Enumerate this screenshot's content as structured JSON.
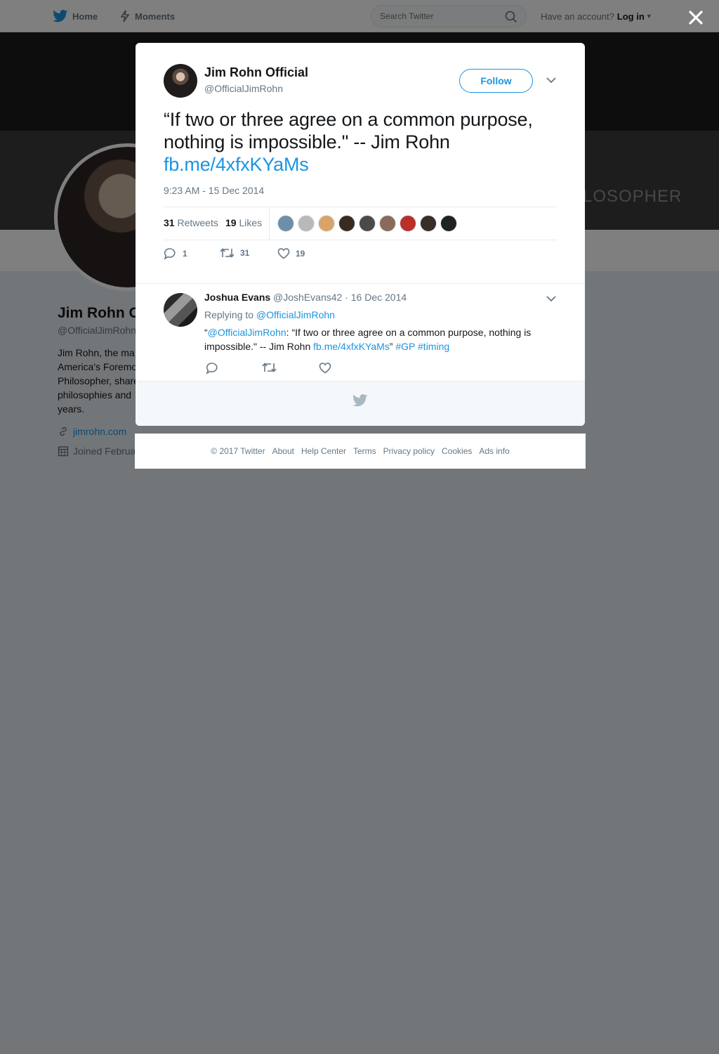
{
  "topbar": {
    "home_label": "Home",
    "moments_label": "Moments",
    "search_placeholder": "Search Twitter",
    "account_prompt": "Have an account?",
    "login_label": "Log in"
  },
  "banner": {
    "text": "LOSOPHER"
  },
  "profile": {
    "name": "Jim Rohn O",
    "handle": "@OfficialJimRohn",
    "bio_lines": [
      "Jim Rohn, the ma",
      "America's Foremo",
      "Philosopher, share",
      "philosophies and",
      "years."
    ],
    "website": "jimrohn.com",
    "joined": "Joined Februa"
  },
  "tweet": {
    "author_name": "Jim Rohn Official",
    "author_handle": "@OfficialJimRohn",
    "follow_label": "Follow",
    "text": "“If two or three agree on a common purpose, nothing is impossible.\" -- Jim Rohn ",
    "link": "fb.me/4xfxKYaMs",
    "timestamp": "9:23 AM - 15 Dec 2014",
    "retweets_count": "31",
    "retweets_label": "Retweets",
    "likes_count": "19",
    "likes_label": "Likes",
    "replies_action_count": "1",
    "retweets_action_count": "31",
    "likes_action_count": "19",
    "liker_colors": [
      "#6f8fa8",
      "#b9b9b9",
      "#d8a46a",
      "#3b2a22",
      "#4a4a4a",
      "#8a6a5a",
      "#b9302a",
      "#3a2c26",
      "#222222"
    ]
  },
  "reply": {
    "name": "Joshua Evans",
    "handle": "@JoshEvans42",
    "date": "· 16 Dec 2014",
    "replying_prefix": "Replying to",
    "replying_to": "@OfficialJimRohn",
    "quote_open": "“",
    "mention": "@OfficialJimRohn",
    "text_main": ": “If two or three agree on a common purpose, nothing is impossible.\" -- Jim Rohn ",
    "link": "fb.me/4xfxKYaMs",
    "close_quote": "”",
    "hashtag1": "#GP",
    "hashtag2": "#timing"
  },
  "footer": {
    "copyright": "© 2017 Twitter",
    "links": [
      "About",
      "Help Center",
      "Terms",
      "Privacy policy",
      "Cookies",
      "Ads info"
    ]
  },
  "colors": {
    "twitter_blue": "#1b95e0",
    "overlay": "rgba(0,0,0,0.5)"
  }
}
